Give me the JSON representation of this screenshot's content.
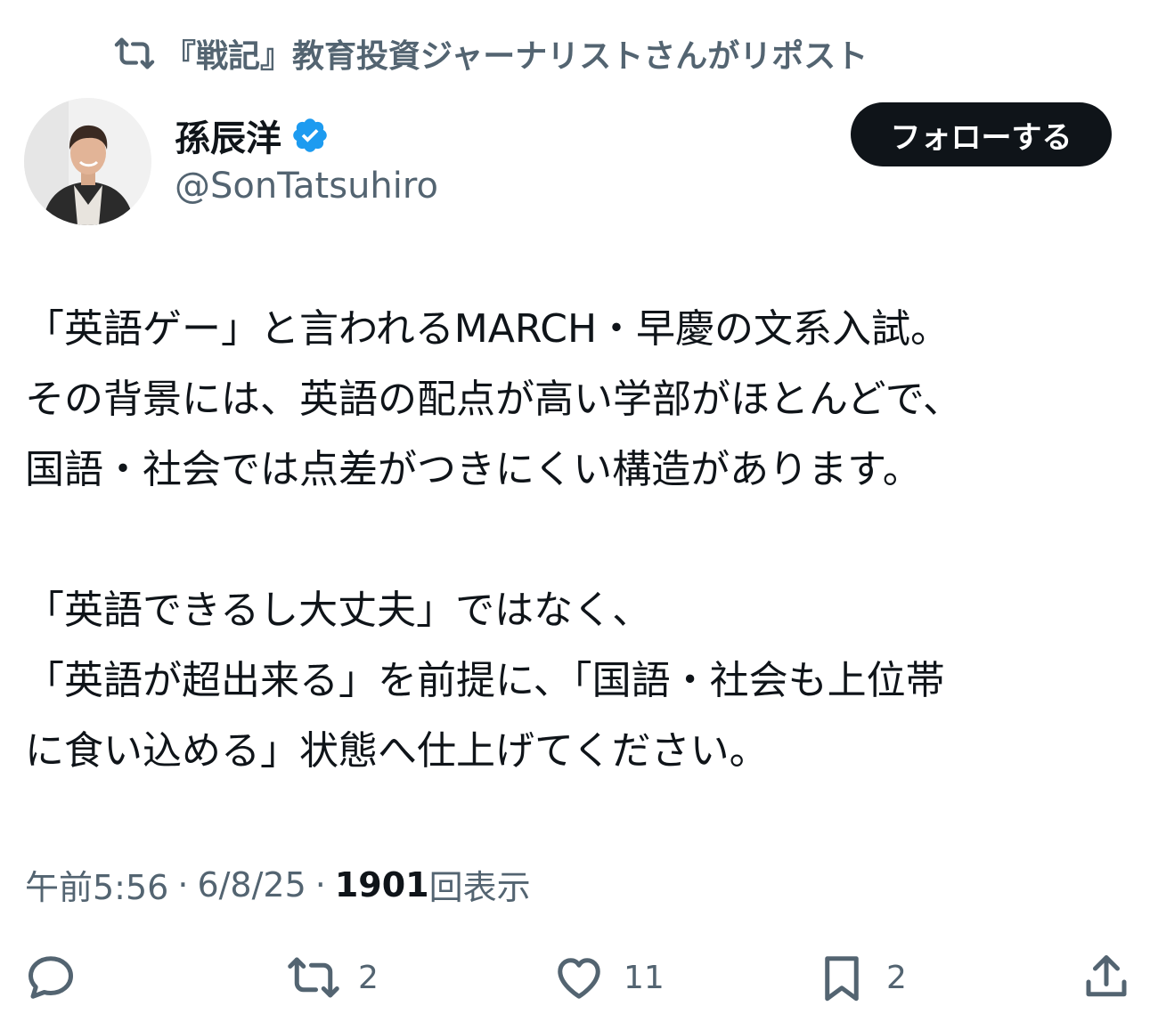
{
  "repost": {
    "text": "『戦記』教育投資ジャーナリストさんがリポスト",
    "icon": "repost-icon"
  },
  "author": {
    "display_name": "孫辰洋",
    "handle": "@SonTatsuhiro",
    "verified_icon": "verified-badge-icon",
    "verified_color": "#1d9bf0"
  },
  "follow_button": {
    "label": "フォローする"
  },
  "tweet": {
    "lines": [
      "「英語ゲー」と言われるMARCH・早慶の文系入試。",
      "その背景には、英語の配点が高い学部がほとんどで、",
      "国語・社会では点差がつきにくい構造があります。",
      "",
      "「英語できるし大丈夫」ではなく、",
      "「英語が超出来る」を前提に、「国語・社会も上位帯",
      "に食い込める」状態へ仕上げてください。"
    ]
  },
  "meta": {
    "time": "午前5:56",
    "date": "6/8/25",
    "views_count": "1901",
    "views_label": "回表示",
    "separator": "·"
  },
  "actions": {
    "reply": {
      "icon": "reply-icon",
      "count": ""
    },
    "repost": {
      "icon": "repost-icon",
      "count": "2"
    },
    "like": {
      "icon": "heart-icon",
      "count": "11"
    },
    "bookmark": {
      "icon": "bookmark-icon",
      "count": "2"
    },
    "share": {
      "icon": "share-icon",
      "count": ""
    }
  },
  "colors": {
    "text_primary": "#0f1419",
    "text_secondary": "#536471",
    "accent": "#1d9bf0",
    "button_bg": "#0f1419"
  }
}
